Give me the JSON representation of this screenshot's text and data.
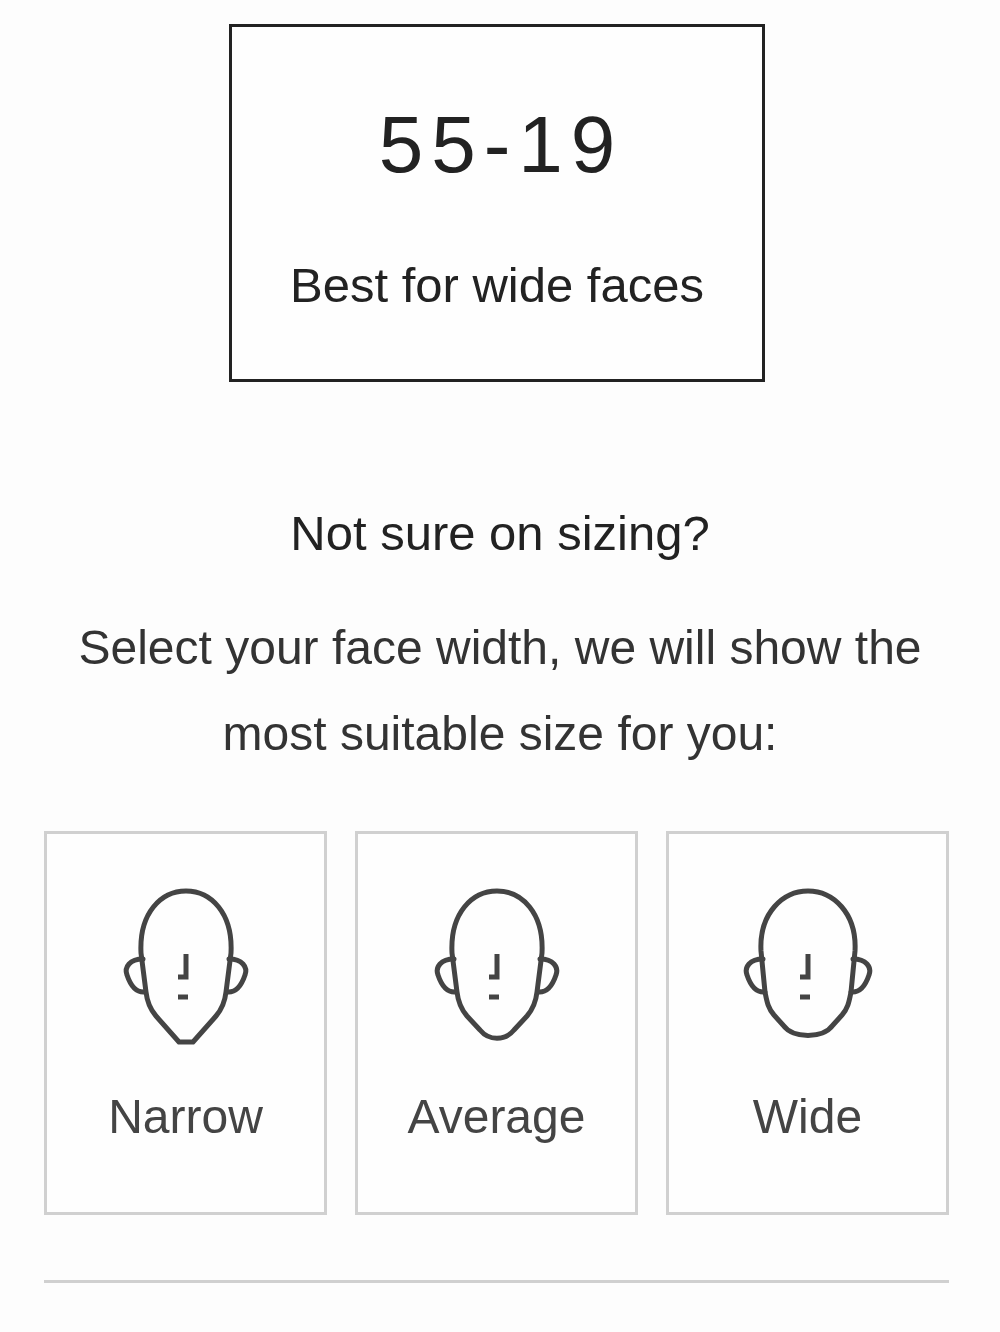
{
  "size_card": {
    "size": "55-19",
    "description": "Best for wide faces"
  },
  "sizing_help": {
    "heading": "Not sure on sizing?",
    "instruction": "Select your face width, we will show the most suitable size for you:"
  },
  "face_widths": [
    {
      "kind": "narrow",
      "label": "Narrow",
      "selected": false
    },
    {
      "kind": "average",
      "label": "Average",
      "selected": false
    },
    {
      "kind": "wide",
      "label": "Wide",
      "selected": false
    }
  ]
}
